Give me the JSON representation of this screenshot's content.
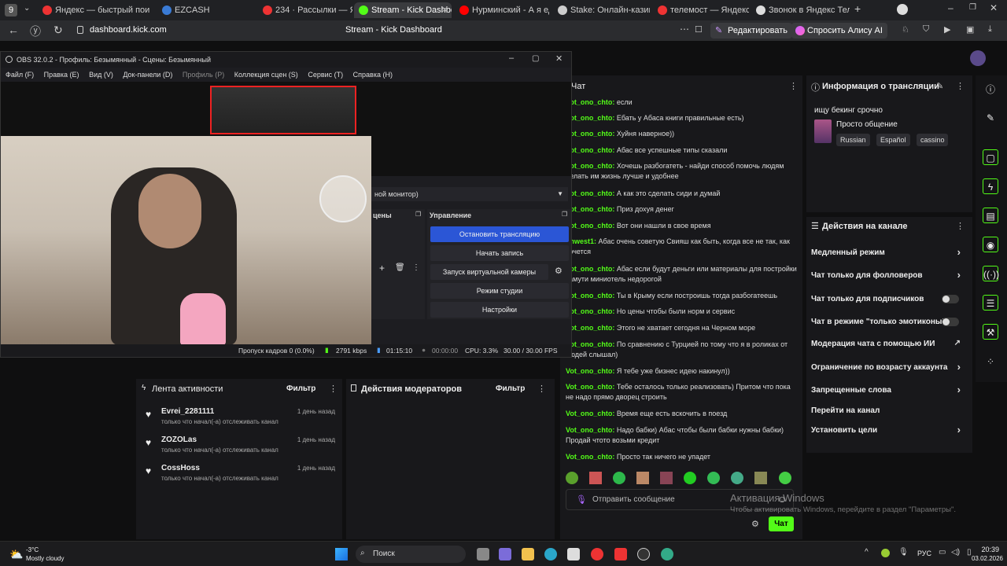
{
  "browser": {
    "tabs": [
      {
        "label": "Яндекс — быстрый пои",
        "color": "#e33"
      },
      {
        "label": "EZCASH",
        "color": "#3a7bd5"
      },
      {
        "label": "234 · Рассылки — Яндек",
        "color": "#e33"
      },
      {
        "label": "Stream - Kick Dashbo",
        "color": "#53fc18"
      },
      {
        "label": "Нурминский - А я еду",
        "color": "#f00"
      },
      {
        "label": "Stake: Онлайн-казино и",
        "color": "#ccc"
      },
      {
        "label": "телемост — Яндекс: на",
        "color": "#e33"
      },
      {
        "label": "Звонок в Яндекс Телем",
        "color": "#ddd"
      }
    ],
    "url": "dashboard.kick.com",
    "page_title": "Stream - Kick Dashboard",
    "edit_label": "Редактировать",
    "alice_label": "Спросить Алису AI"
  },
  "obs": {
    "title": "OBS 32.0.2 - Профиль: Безымянный - Сцены: Безымянный",
    "menu": [
      "Файл (F)",
      "Правка (E)",
      "Вид (V)",
      "Док-панели (D)",
      "Профиль (P)",
      "Коллекция сцен (S)",
      "Сервис (T)",
      "Справка (H)"
    ],
    "monitor_select": "ной монитор)",
    "scenes_header": "цены",
    "controls_header": "Управление",
    "buttons": {
      "stop_stream": "Остановить трансляцию",
      "start_record": "Начать запись",
      "virtual_cam": "Запуск виртуальной камеры",
      "studio_mode": "Режим студии",
      "settings": "Настройки"
    },
    "status": {
      "dropped": "Пропуск кадров 0 (0.0%)",
      "bitrate": "2791 kbps",
      "stream_time": "01:15:10",
      "record_time": "00:00:00",
      "cpu": "CPU: 3.3%",
      "fps": "30.00 / 30.00 FPS"
    }
  },
  "activity": {
    "title": "Лента активности",
    "filter": "Фильтр",
    "items": [
      {
        "name": "Evrei_2281111",
        "sub": "только что начал(-а) отслеживать канал",
        "time": "1 день назад"
      },
      {
        "name": "ZOZOLas",
        "sub": "только что начал(-а) отслеживать канал",
        "time": "1 день назад"
      },
      {
        "name": "CossHoss",
        "sub": "только что начал(-а) отслеживать канал",
        "time": "1 день назад"
      }
    ]
  },
  "moderators": {
    "title": "Действия модераторов",
    "filter": "Фильтр"
  },
  "chat": {
    "title": "Чат",
    "messages": [
      {
        "user": "Vot_ono_chto:",
        "text": "если"
      },
      {
        "user": "Vot_ono_chto:",
        "text": "Ебать у Абаса книги правильные есть)"
      },
      {
        "user": "Vot_ono_chto:",
        "text": "Хуйня наверное))"
      },
      {
        "user": "Vot_ono_chto:",
        "text": "Абас все успешные типы сказали"
      },
      {
        "user": "Vot_ono_chto:",
        "text": "Хочешь разбогатеть - найди способ помочь людям делать им жизнь лучше и удобнее"
      },
      {
        "user": "Vot_ono_chto:",
        "text": "А как это сделать сиди и думай"
      },
      {
        "user": "Vot_ono_chto:",
        "text": "Приз дохуя денег"
      },
      {
        "user": "Vot_ono_chto:",
        "text": "Вот они нашли в свое время"
      },
      {
        "user": "unwest1:",
        "text": "Абас очень советую Свияш как быть, когда все не так, как хочется"
      },
      {
        "user": "Vot_ono_chto:",
        "text": "Абас если будут деньги или материалы для постройки замути миниотель недорогой"
      },
      {
        "user": "Vot_ono_chto:",
        "text": "Ты в Крыму если построишь тогда разбогатеешь"
      },
      {
        "user": "Vot_ono_chto:",
        "text": "Но цены чтобы были норм и сервис"
      },
      {
        "user": "Vot_ono_chto:",
        "text": "Этого не хватает сегодня на Черном море"
      },
      {
        "user": "Vot_ono_chto:",
        "text": "По сравнению с Турцией по тому что я в роликах от людей слышал)"
      },
      {
        "user": "Vot_ono_chto:",
        "text": "Я тебе уже бизнес идею накинул))"
      },
      {
        "user": "Vot_ono_chto:",
        "text": "Тебе осталось только реализовать) Притом что пока не надо прямо дворец строить"
      },
      {
        "user": "Vot_ono_chto:",
        "text": "Время еще есть вскочить в поезд"
      },
      {
        "user": "Vot_ono_chto:",
        "text": "Надо бабки) Абас чтобы были бабки нужны бабки) Продай чтото возьми кредит"
      },
      {
        "user": "Vot_ono_chto:",
        "text": "Просто так ничего не упадет"
      }
    ],
    "input_placeholder": "Отправить сообщение",
    "send_label": "Чат"
  },
  "stream_info": {
    "title": "Информация о трансляции",
    "stream_title": "ищу бекинг срочно",
    "category": "Просто общение",
    "tags": [
      "Russian",
      "Español",
      "cassino"
    ]
  },
  "channel_actions": {
    "title": "Действия на канале",
    "items": [
      {
        "label": "Медленный режим",
        "control": "chevron"
      },
      {
        "label": "Чат только для фолловеров",
        "control": "chevron"
      },
      {
        "label": "Чат только для подписчиков",
        "control": "toggle"
      },
      {
        "label": "Чат в режиме \"только эмотиконы\"",
        "control": "toggle"
      },
      {
        "label": "Модерация чата с помощью ИИ",
        "control": "external"
      },
      {
        "label": "Ограничение по возрасту аккаунта",
        "control": "chevron"
      },
      {
        "label": "Запрещенные слова",
        "control": "chevron"
      },
      {
        "label": "Перейти на канал",
        "control": "none"
      },
      {
        "label": "Установить цели",
        "control": "chevron"
      }
    ]
  },
  "windows_activation": {
    "title": "Активация Windows",
    "subtitle": "Чтобы активировать Windows, перейдите в раздел \"Параметры\"."
  },
  "taskbar": {
    "weather_temp": "-3°C",
    "weather_desc": "Mostly cloudy",
    "search_label": "Поиск",
    "lang": "РУС",
    "time": "20:39",
    "date": "03.02.2026"
  }
}
